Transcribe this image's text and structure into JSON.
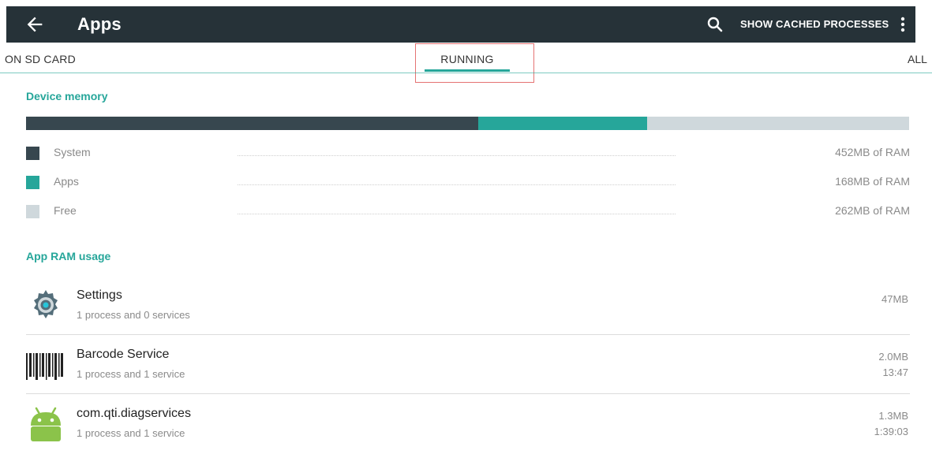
{
  "appbar": {
    "title": "Apps",
    "cached_label": "SHOW CACHED PROCESSES",
    "bg": "#263238"
  },
  "tabs": {
    "left": "ON SD CARD",
    "center": "RUNNING",
    "right": "ALL",
    "accent": "#26a69a"
  },
  "device_memory": {
    "title": "Device memory",
    "bar": [
      {
        "name": "System",
        "mb": 452,
        "color": "#37474f"
      },
      {
        "name": "Apps",
        "mb": 168,
        "color": "#26a69a"
      },
      {
        "name": "Free",
        "mb": 262,
        "color": "#cfd8dc"
      }
    ],
    "legend": [
      {
        "label": "System",
        "value": "452MB of RAM",
        "color": "#37474f"
      },
      {
        "label": "Apps",
        "value": "168MB of RAM",
        "color": "#26a69a"
      },
      {
        "label": "Free",
        "value": "262MB of RAM",
        "color": "#cfd8dc"
      }
    ]
  },
  "app_ram": {
    "title": "App RAM usage",
    "apps": [
      {
        "name": "Settings",
        "sub": "1 process and 0 services",
        "size": "47MB",
        "time": "",
        "icon": "settings-gear-icon"
      },
      {
        "name": "Barcode Service",
        "sub": "1 process and 1 service",
        "size": "2.0MB",
        "time": "13:47",
        "icon": "barcode-icon"
      },
      {
        "name": "com.qti.diagservices",
        "sub": "1 process and 1 service",
        "size": "1.3MB",
        "time": "1:39:03",
        "icon": "android-icon"
      }
    ]
  }
}
